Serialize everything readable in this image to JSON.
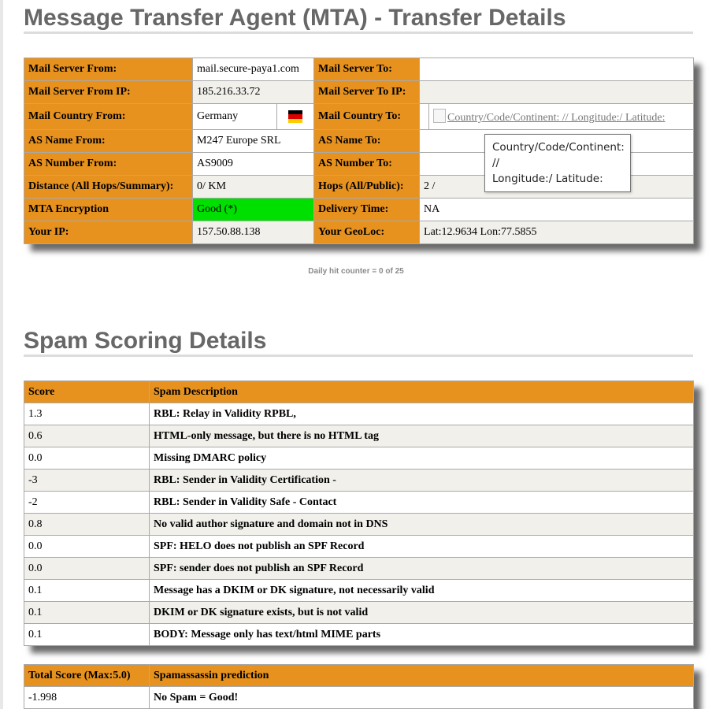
{
  "mta": {
    "title": "Message Transfer Agent (MTA) - Transfer Details",
    "rows": [
      {
        "l1": "Mail Server From:",
        "v1": "mail.secure-paya1.com",
        "l2": "Mail Server To:",
        "v2": ""
      },
      {
        "l1": "Mail Server From IP:",
        "v1": "185.216.33.72",
        "l2": "Mail Server To IP:",
        "v2": ""
      },
      {
        "l1": "Mail Country From:",
        "v1": "Germany",
        "l2": "Mail Country To:",
        "v2": "Country/Code/Continent: // Longitude:/ Latitude:"
      },
      {
        "l1": "AS Name From:",
        "v1": "M247 Europe SRL",
        "l2": "AS Name To:",
        "v2": ""
      },
      {
        "l1": "AS Number From:",
        "v1": "AS9009",
        "l2": "AS Number To:",
        "v2": ""
      },
      {
        "l1": "Distance (All Hops/Summary):",
        "v1": "0/ KM",
        "l2": "Hops (All/Public):",
        "v2": "2 /"
      },
      {
        "l1": "MTA Encryption",
        "v1": "Good (*)",
        "l2": "Delivery Time:",
        "v2": "NA"
      },
      {
        "l1": "Your IP:",
        "v1": "157.50.88.138",
        "l2": "Your GeoLoc:",
        "v2": "Lat:12.9634 Lon:77.5855"
      }
    ],
    "flag_icon": "germany-flag-icon",
    "flag_colors": [
      "#000000",
      "#dd0000",
      "#ffce00"
    ],
    "tooltip": {
      "line1": "Country/Code/Continent:",
      "line2": "//",
      "line3": "Longitude:/ Latitude:"
    }
  },
  "counter": "Daily hit counter = 0 of 25",
  "spam": {
    "title": "Spam Scoring Details",
    "headers": {
      "score": "Score",
      "desc": "Spam Description"
    },
    "rows": [
      {
        "score": "1.3",
        "desc": "RBL: Relay in Validity RPBL,"
      },
      {
        "score": "0.6",
        "desc": "HTML-only message, but there is no HTML tag"
      },
      {
        "score": "0.0",
        "desc": "Missing DMARC policy"
      },
      {
        "score": "-3",
        "desc": "RBL: Sender in Validity Certification -"
      },
      {
        "score": "-2",
        "desc": "RBL: Sender in Validity Safe - Contact"
      },
      {
        "score": "0.8",
        "desc": "No valid author signature and domain not in DNS"
      },
      {
        "score": "0.0",
        "desc": "SPF: HELO does not publish an SPF Record"
      },
      {
        "score": "0.0",
        "desc": "SPF: sender does not publish an SPF Record"
      },
      {
        "score": "0.1",
        "desc": "Message has a DKIM or DK signature, not necessarily valid"
      },
      {
        "score": "0.1",
        "desc": "DKIM or DK signature exists, but is not valid"
      },
      {
        "score": "0.1",
        "desc": "BODY: Message only has text/html MIME parts"
      }
    ]
  },
  "total": {
    "headers": {
      "score": "Total Score (Max:5.0)",
      "pred": "Spamassassin prediction"
    },
    "score": "-1.998",
    "prediction": "No Spam = Good!"
  },
  "colors": {
    "header": "#e7921f",
    "alt_row": "#f1f0eb",
    "good": "#00e000",
    "nospam": "#008000",
    "title": "#676767"
  }
}
